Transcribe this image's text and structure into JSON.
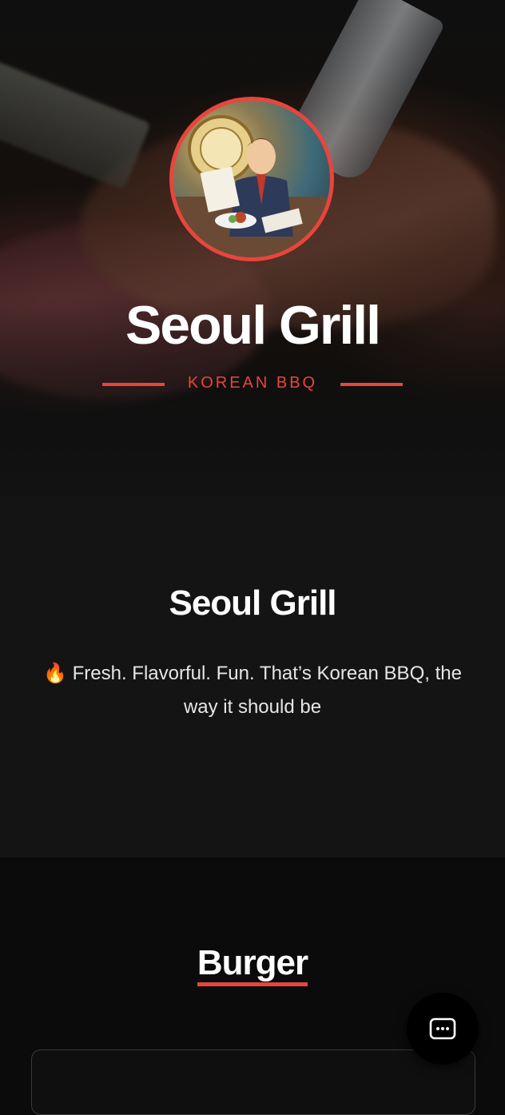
{
  "hero": {
    "title": "Seoul Grill",
    "tagline": "KOREAN BBQ",
    "background_icon": "steak-photo",
    "avatar_icon": "restaurant-mascot-avatar"
  },
  "about": {
    "title": "Seoul Grill",
    "description": "🔥 Fresh. Flavorful. Fun. That’s Korean BBQ, the way it should be"
  },
  "menu": {
    "category": "Burger"
  },
  "chat": {
    "icon": "chat-icon"
  },
  "colors": {
    "accent": "#e8453c",
    "background": "#0b0b0b",
    "section_bg": "#141414",
    "text": "#ffffff"
  }
}
